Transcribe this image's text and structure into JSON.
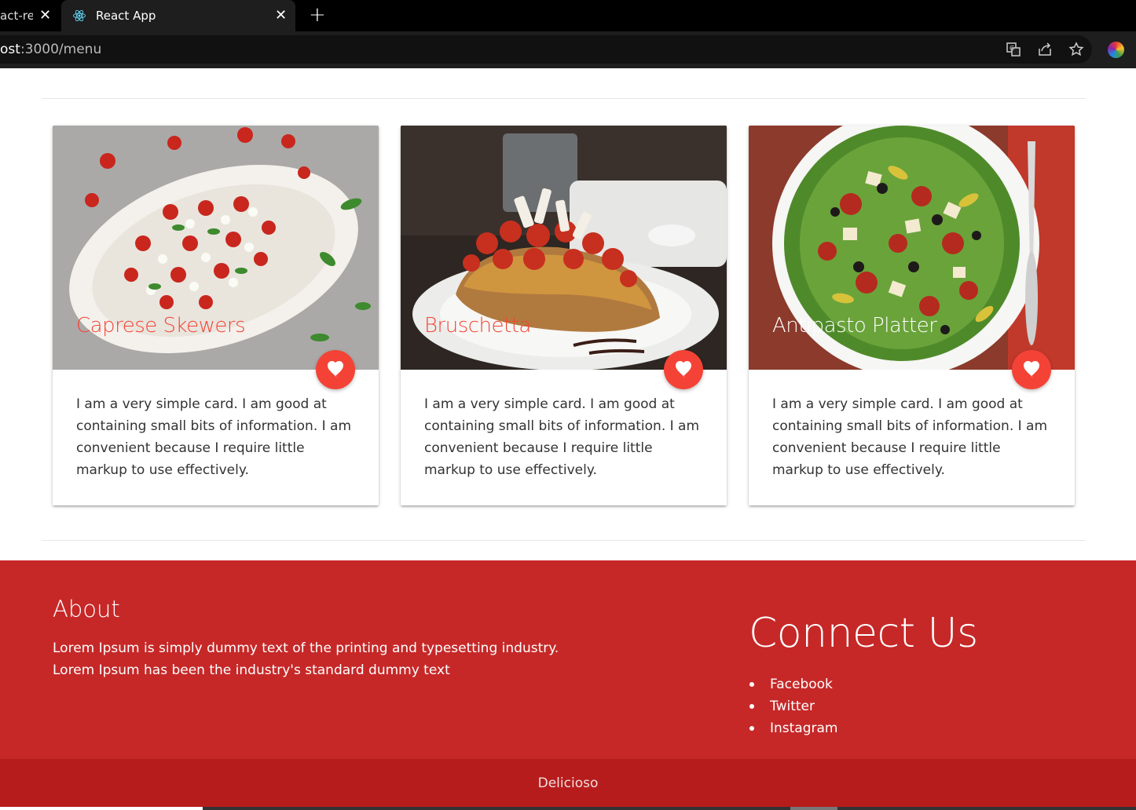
{
  "browser": {
    "tabs": [
      {
        "title": "act-re",
        "active": false
      },
      {
        "title": "React App",
        "active": true
      }
    ],
    "url_prefix": "ost",
    "url_rest": ":3000/menu",
    "icons": [
      "translate-icon",
      "share-icon",
      "star-icon",
      "profile-icon"
    ]
  },
  "cards": [
    {
      "title": "Caprese Skewers",
      "title_color": "#f44336",
      "text": "I am a very simple card. I am good at containing small bits of information. I am convenient because I require little markup to use effectively."
    },
    {
      "title": "Bruschetta",
      "title_color": "#f44336",
      "text": "I am a very simple card. I am good at containing small bits of information. I am convenient because I require little markup to use effectively."
    },
    {
      "title": "Antipasto Platter",
      "title_color": "#ffffff",
      "text": "I am a very simple card. I am good at containing small bits of information. I am convenient because I require little markup to use effectively."
    }
  ],
  "footer": {
    "about_title": "About",
    "about_line1": "Lorem Ipsum is simply dummy text of the printing and typesetting industry.",
    "about_line2": "Lorem Ipsum has been the industry's standard dummy text",
    "connect_title": "Connect Us",
    "links": [
      "Facebook",
      "Twitter",
      "Instagram"
    ],
    "copyright": "Delicioso"
  },
  "colors": {
    "accent": "#f44336",
    "footer": "#c62828",
    "footer_copyright": "#b71c1c"
  }
}
